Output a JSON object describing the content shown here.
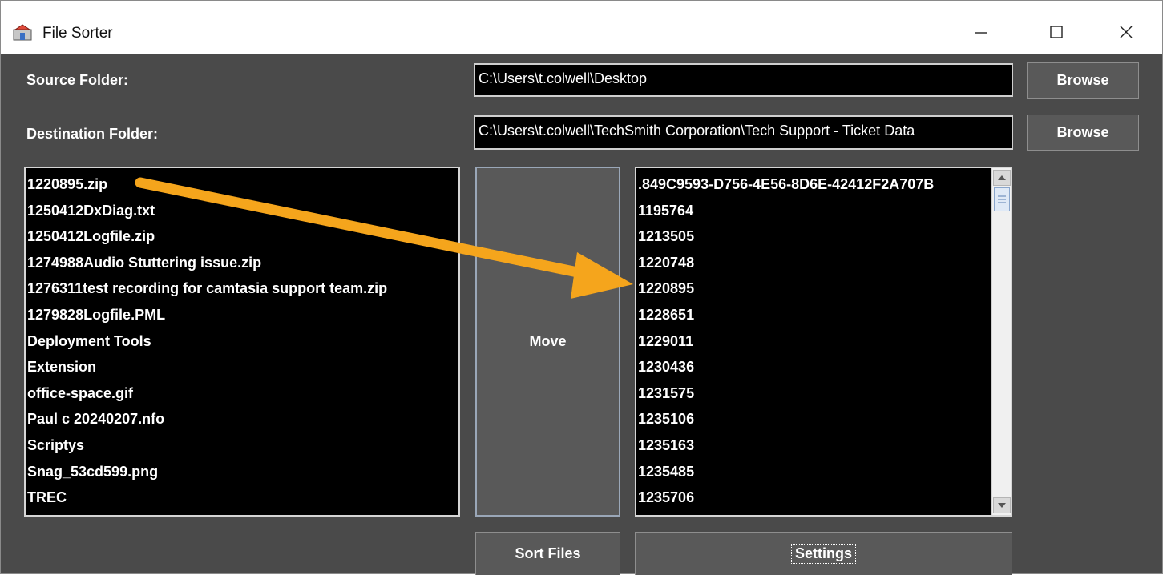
{
  "window": {
    "title": "File Sorter",
    "minimize_glyph": "—",
    "maximize_glyph": "☐",
    "close_glyph": "✕"
  },
  "source": {
    "label": "Source Folder:",
    "path": "C:\\Users\\t.colwell\\Desktop",
    "browse_label": "Browse"
  },
  "destination": {
    "label": "Destination Folder:",
    "path": "C:\\Users\\t.colwell\\TechSmith Corporation\\Tech Support - Ticket Data",
    "browse_label": "Browse"
  },
  "source_list": {
    "items": [
      "1220895.zip",
      "1250412DxDiag.txt",
      "1250412Logfile.zip",
      "1274988Audio Stuttering issue.zip",
      "1276311test recording for camtasia support team.zip",
      "1279828Logfile.PML",
      "Deployment Tools",
      "Extension",
      "office-space.gif",
      "Paul c 20240207.nfo",
      "Scriptys",
      "Snag_53cd599.png",
      "TREC"
    ]
  },
  "destination_list": {
    "items": [
      ".849C9593-D756-4E56-8D6E-42412F2A707B",
      "1195764",
      "1213505",
      "1220748",
      "1220895",
      "1228651",
      "1229011",
      "1230436",
      "1231575",
      "1235106",
      "1235163",
      "1235485",
      "1235706"
    ]
  },
  "actions": {
    "move_label": "Move",
    "sort_label": "Sort Files",
    "settings_label": "Settings"
  },
  "colors": {
    "window_bg": "#4a4a4a",
    "list_bg": "#000000",
    "button_bg": "#595959",
    "annotation_arrow": "#f5a51c"
  },
  "icons": {
    "app": "file-sorter-app-icon",
    "scroll_up": "scroll-up-arrow-icon",
    "scroll_down": "scroll-down-arrow-icon"
  }
}
